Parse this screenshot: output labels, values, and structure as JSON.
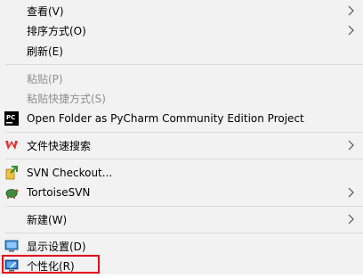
{
  "menu": {
    "items": [
      {
        "label": "查看(V)"
      },
      {
        "label": "排序方式(O)"
      },
      {
        "label": "刷新(E)"
      },
      {
        "label": "粘贴(P)"
      },
      {
        "label": "粘贴快捷方式(S)"
      },
      {
        "label": "Open Folder as PyCharm Community Edition Project"
      },
      {
        "label": "文件快速搜索"
      },
      {
        "label": "SVN Checkout..."
      },
      {
        "label": "TortoiseSVN"
      },
      {
        "label": "新建(W)"
      },
      {
        "label": "显示设置(D)"
      },
      {
        "label": "个性化(R)"
      }
    ]
  },
  "colors": {
    "menu_background": "#f2f2f2",
    "disabled_text": "#8f8f8f",
    "highlight_border": "#e0001b",
    "separator": "#d9d9d9"
  },
  "icons": {
    "pycharm": "pycharm-icon",
    "wps": "wps-search-icon",
    "svn_checkout": "svn-checkout-icon",
    "tortoise": "tortoisesvn-icon",
    "display": "display-settings-icon",
    "personalize": "personalize-icon"
  }
}
